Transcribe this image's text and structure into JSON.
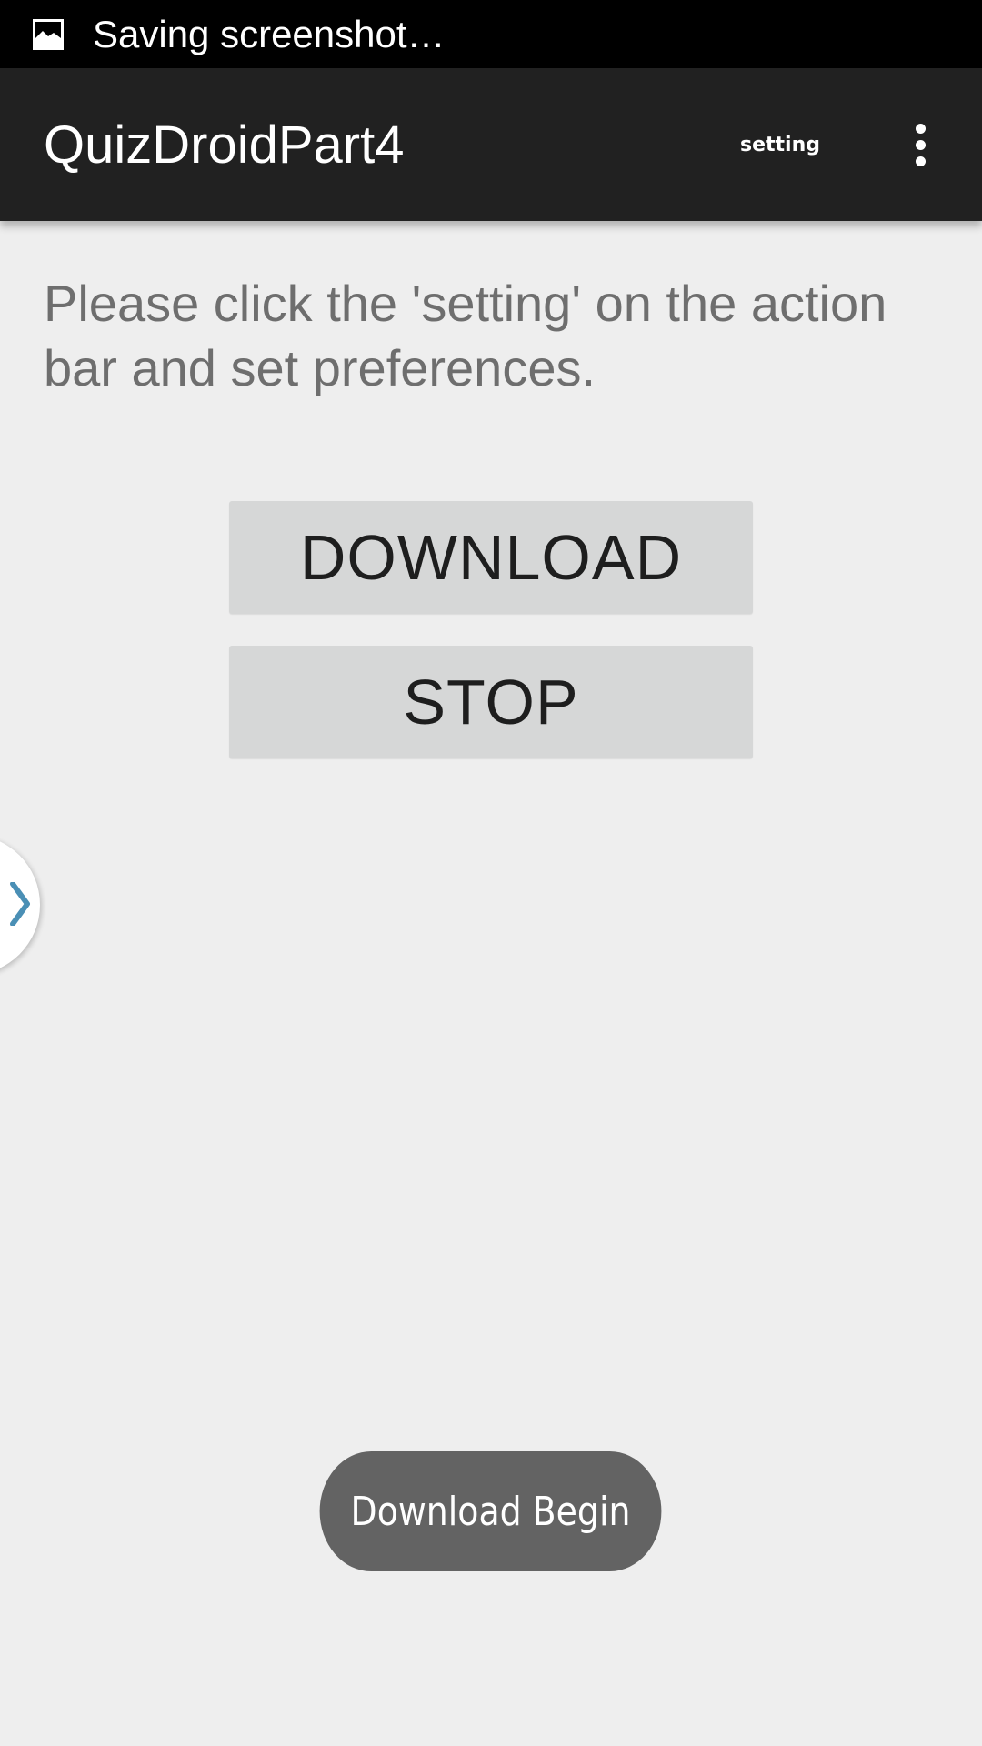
{
  "status_bar": {
    "icon": "image-icon",
    "text": "Saving screenshot…"
  },
  "action_bar": {
    "title": "QuizDroidPart4",
    "setting_label": "setting",
    "overflow_icon": "more-vert-icon"
  },
  "main": {
    "instructions": "Please click the 'setting' on the action bar and set preferences.",
    "download_label": "DOWNLOAD",
    "stop_label": "STOP"
  },
  "drawer_handle": {
    "icon": "chevron-right-icon",
    "color": "#4a8fb5"
  },
  "toast": {
    "text": "Download Begin"
  },
  "colors": {
    "status_bar_bg": "#000000",
    "action_bar_bg": "#212121",
    "background": "#eeeeee",
    "button_bg": "#d6d7d7",
    "toast_bg": "#636363"
  }
}
